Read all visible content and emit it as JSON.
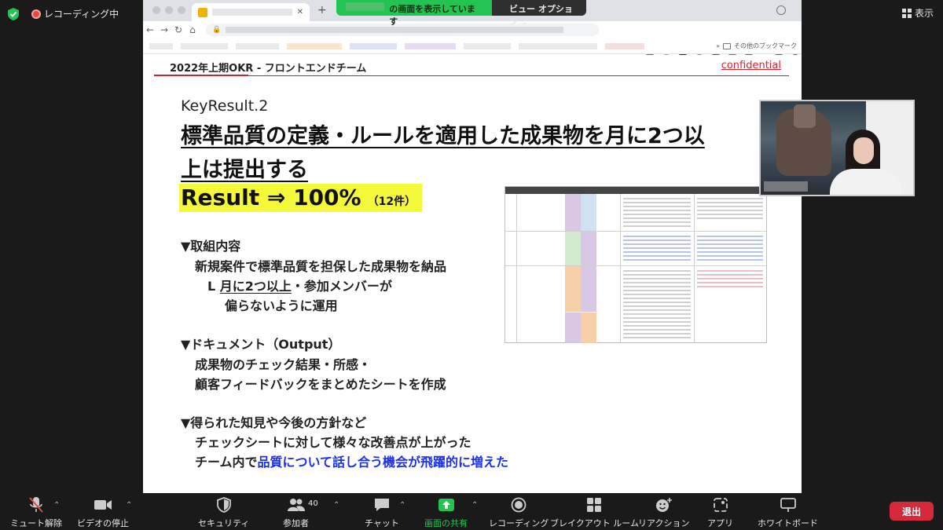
{
  "zoom": {
    "recording_label": "レコーディング中",
    "view_label": "表示",
    "share_banner": "の画面を表示しています",
    "view_options": "ビュー オプション"
  },
  "slide": {
    "header_title": "2022年上期OKR - フロントエンドチーム",
    "confidential": "confidential",
    "kr_label": "KeyResult.2",
    "headline_line1": "標準品質の定義・ルールを適用した成果物を月に2つ以",
    "headline_line2": "上は提出する",
    "result_main": "Result ⇒ 100%",
    "result_sub": "（12件）",
    "section1_title": "▼取組内容",
    "section1_line1": "新規案件で標準品質を担保した成果物を納品",
    "section1_line2_prefix": "L ",
    "section1_line2_ul": "月に2つ以上",
    "section1_line2_suffix": "・参加メンバーが",
    "section1_line3": "偏らないように運用",
    "section2_title": "▼ドキュメント（Output）",
    "section2_line1": "成果物のチェック結果・所感・",
    "section2_line2": "顧客フィードバックをまとめたシートを作成",
    "section3_title": "▼得られた知見や今後の方針など",
    "section3_line1": "チェックシートに対して様々な改善点が上がった",
    "section3_line2_prefix": "チーム内で",
    "section3_line2_blue": "品質について話し合う機会が飛躍的に増えた"
  },
  "browser": {
    "bookmarks_other": "その他のブックマーク"
  },
  "toolbar": {
    "mute": "ミュート解除",
    "video": "ビデオの停止",
    "security": "セキュリティ",
    "participants": "参加者",
    "participants_count": "40",
    "chat": "チャット",
    "share": "画面の共有",
    "record": "レコーディング",
    "breakout": "ブレイクアウト ルーム",
    "reactions": "リアクション",
    "apps": "アプリ",
    "whiteboard": "ホワイトボード",
    "leave": "退出"
  },
  "colors": {
    "share_green": "#23c552",
    "leave_red": "#d6293a",
    "highlight_yellow": "#f4f73a",
    "accent_blue": "#1b2ff0",
    "confidential_red": "#e0202a"
  }
}
